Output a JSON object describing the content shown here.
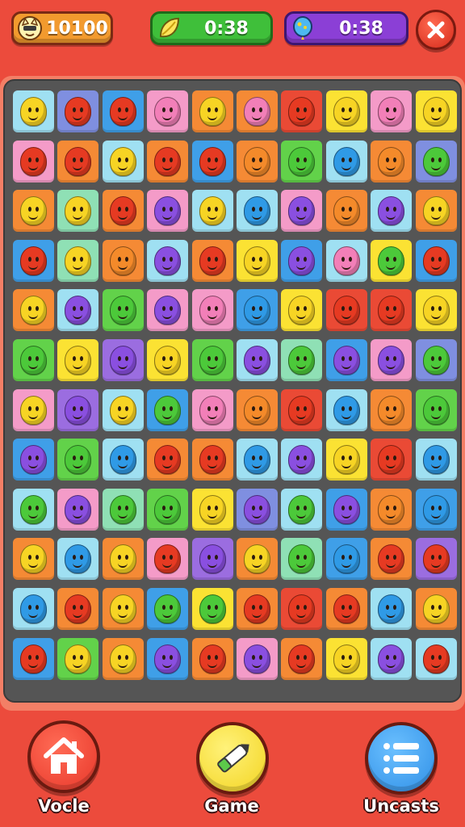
{
  "hud": {
    "score": {
      "value": "10100",
      "icon": "cat-face-icon"
    },
    "timer_green": {
      "value": "0:38",
      "icon": "leaf-icon"
    },
    "timer_purple": {
      "value": "0:38",
      "icon": "balloon-icon"
    },
    "close_icon": "close-icon"
  },
  "palette": {
    "yellow": "#f7d424",
    "red": "#e63a22",
    "orange": "#f48a2a",
    "pink": "#f27fb8",
    "green": "#4cc93a",
    "blue": "#2f9ae6",
    "purple": "#8a4fe0",
    "bg_lightblue": "#9fe0f2",
    "bg_pink": "#f49bc8",
    "bg_orange": "#f58a35",
    "bg_red": "#ea4a35",
    "bg_yellow": "#fbe233",
    "bg_green": "#62d24a",
    "bg_blue": "#3f9fe8",
    "bg_purple": "#9b6de0",
    "bg_mint": "#8fe0b5",
    "bg_periwinkle": "#7f8fe0"
  },
  "board": {
    "rows": 12,
    "cols": 10,
    "tiles": [
      [
        "lightblue:yellow",
        "periwinkle:red",
        "blue:red",
        "pink:pink",
        "orange:yellow",
        "orange:pink",
        "red:red",
        "yellow:yellow",
        "pink:pink",
        "yellow:yellow"
      ],
      [
        "pink:red",
        "orange:red",
        "lightblue:yellow",
        "orange:red",
        "blue:red",
        "orange:orange",
        "green:green",
        "lightblue:blue",
        "orange:orange",
        "periwinkle:green"
      ],
      [
        "orange:yellow",
        "mint:yellow",
        "orange:red",
        "pink:purple",
        "lightblue:yellow",
        "lightblue:blue",
        "pink:purple",
        "orange:orange",
        "lightblue:purple",
        "orange:yellow"
      ],
      [
        "blue:red",
        "mint:yellow",
        "orange:orange",
        "lightblue:purple",
        "orange:red",
        "yellow:yellow",
        "blue:purple",
        "lightblue:pink",
        "yellow:green",
        "blue:red"
      ],
      [
        "orange:yellow",
        "lightblue:purple",
        "green:green",
        "pink:purple",
        "pink:pink",
        "blue:blue",
        "yellow:yellow",
        "red:red",
        "red:red",
        "yellow:yellow"
      ],
      [
        "green:green",
        "yellow:yellow",
        "purple:purple",
        "yellow:yellow",
        "green:green",
        "lightblue:purple",
        "mint:green",
        "blue:purple",
        "pink:purple",
        "periwinkle:green"
      ],
      [
        "pink:yellow",
        "purple:purple",
        "lightblue:yellow",
        "blue:green",
        "pink:pink",
        "orange:orange",
        "red:red",
        "lightblue:blue",
        "orange:orange",
        "green:green"
      ],
      [
        "blue:purple",
        "green:green",
        "lightblue:blue",
        "orange:red",
        "orange:red",
        "lightblue:blue",
        "lightblue:purple",
        "yellow:yellow",
        "red:red",
        "lightblue:blue"
      ],
      [
        "lightblue:green",
        "pink:purple",
        "mint:green",
        "green:green",
        "yellow:yellow",
        "periwinkle:purple",
        "lightblue:green",
        "blue:purple",
        "orange:orange",
        "blue:blue"
      ],
      [
        "orange:yellow",
        "lightblue:blue",
        "orange:yellow",
        "pink:red",
        "purple:purple",
        "orange:yellow",
        "mint:green",
        "blue:blue",
        "orange:red",
        "purple:red"
      ],
      [
        "lightblue:blue",
        "orange:red",
        "orange:yellow",
        "blue:green",
        "yellow:green",
        "orange:red",
        "red:red",
        "orange:red",
        "lightblue:blue",
        "orange:yellow"
      ],
      [
        "blue:red",
        "green:yellow",
        "orange:yellow",
        "blue:purple",
        "orange:red",
        "pink:purple",
        "orange:red",
        "yellow:yellow",
        "lightblue:purple",
        "lightblue:red"
      ]
    ]
  },
  "nav": {
    "home": {
      "label": "Vocle",
      "icon": "house-icon",
      "color": "#e8372a"
    },
    "game": {
      "label": "Game",
      "icon": "pencil-icon",
      "color": "#f3d420"
    },
    "list": {
      "label": "Uncasts",
      "icon": "list-icon",
      "color": "#2f8fe6"
    }
  }
}
